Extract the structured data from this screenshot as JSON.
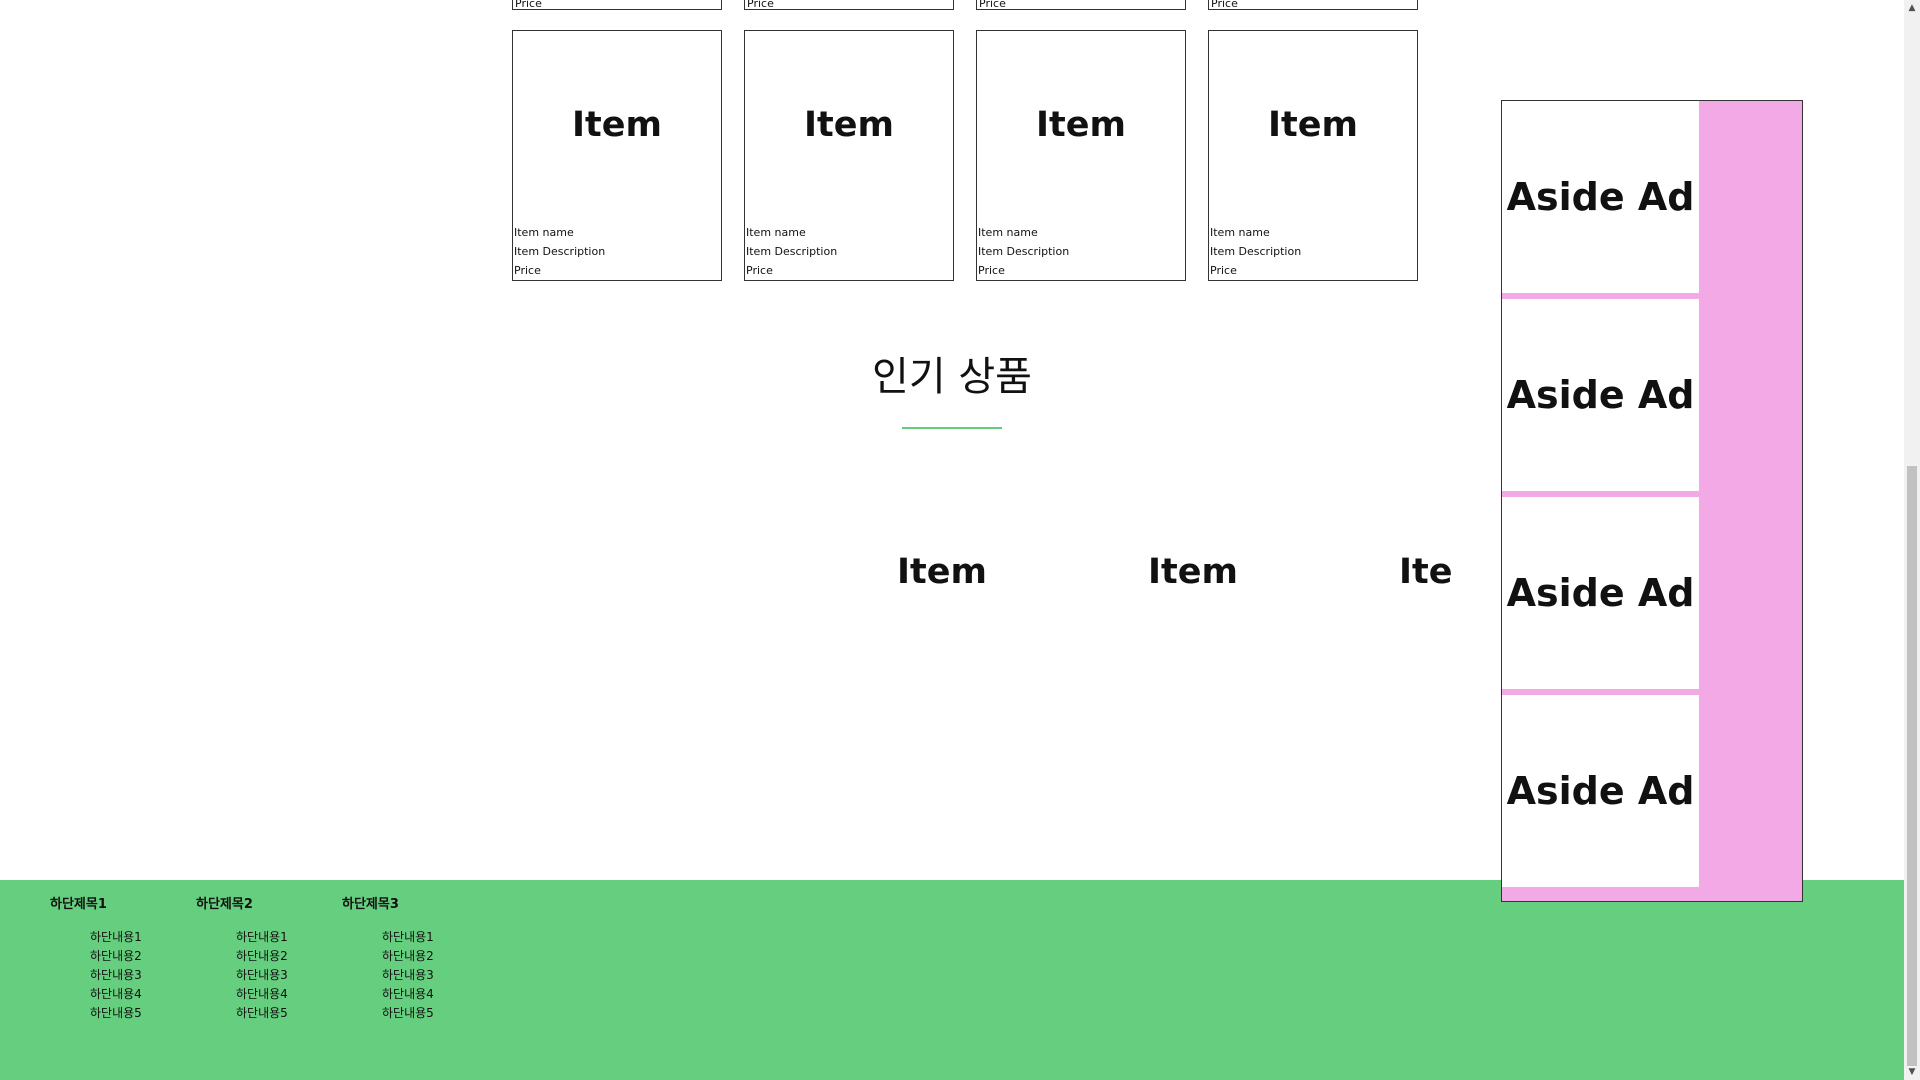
{
  "top_partial_cards": [
    {
      "price": "Price"
    },
    {
      "price": "Price"
    },
    {
      "price": "Price"
    },
    {
      "price": "Price"
    }
  ],
  "products": [
    {
      "title": "Item",
      "name": "Item name",
      "description": "Item Description",
      "price": "Price"
    },
    {
      "title": "Item",
      "name": "Item name",
      "description": "Item Description",
      "price": "Price"
    },
    {
      "title": "Item",
      "name": "Item name",
      "description": "Item Description",
      "price": "Price"
    },
    {
      "title": "Item",
      "name": "Item name",
      "description": "Item Description",
      "price": "Price"
    }
  ],
  "popular": {
    "title": "인기 상품",
    "items": [
      "Item",
      "Item",
      "Item"
    ]
  },
  "aside": {
    "ads": [
      "Aside Ad",
      "Aside Ad",
      "Aside Ad",
      "Aside Ad"
    ]
  },
  "footer": {
    "columns": [
      {
        "title": "하단제목1",
        "items": [
          "하단내용1",
          "하단내용2",
          "하단내용3",
          "하단내용4",
          "하단내용5"
        ]
      },
      {
        "title": "하단제목2",
        "items": [
          "하단내용1",
          "하단내용2",
          "하단내용3",
          "하단내용4",
          "하단내용5"
        ]
      },
      {
        "title": "하단제목3",
        "items": [
          "하단내용1",
          "하단내용2",
          "하단내용3",
          "하단내용4",
          "하단내용5"
        ]
      }
    ]
  },
  "colors": {
    "footer_bg": "#66cf7f",
    "aside_bg": "#f4a9e7",
    "accent_line": "#66cc77"
  },
  "icons": [
    "scroll-up-arrow-icon",
    "scroll-down-arrow-icon"
  ]
}
